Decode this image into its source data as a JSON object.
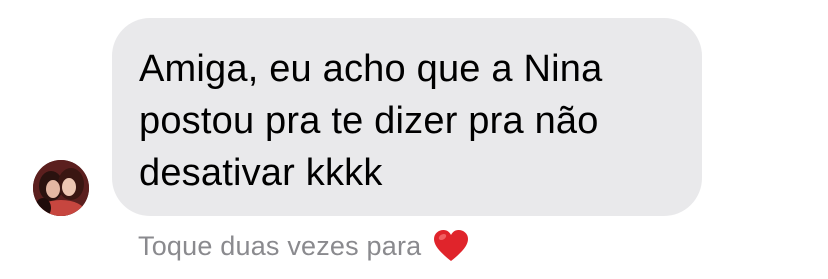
{
  "message": {
    "text": "Amiga, eu acho que a Nina\npostou pra te dizer pra não\ndesativar kkkk"
  },
  "hint": {
    "text": "Toque duas vezes para",
    "icon": "heart-icon"
  },
  "colors": {
    "bubble": "#e9e9eb",
    "hint_text": "#8a8a8e",
    "heart": "#e0242b"
  }
}
